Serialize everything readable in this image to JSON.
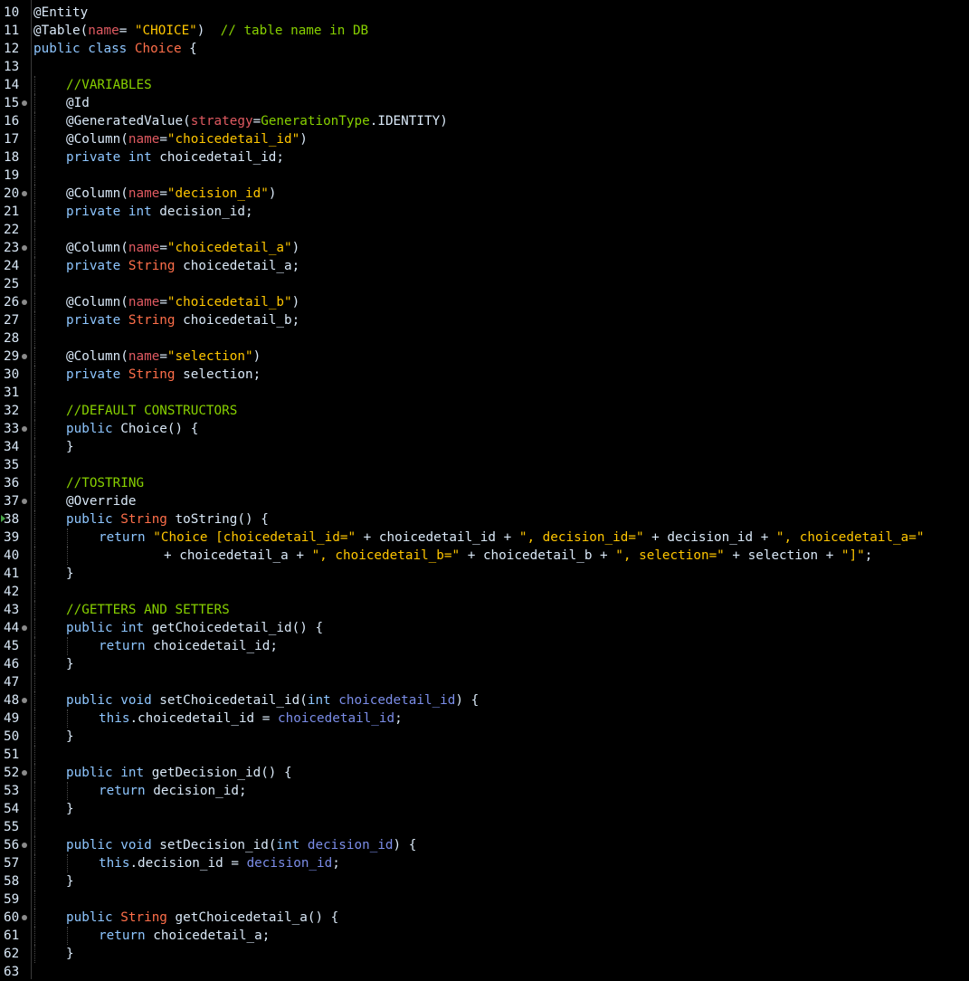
{
  "theme": {
    "background": "#000000",
    "colors": {
      "plain": "#d9e8f7",
      "keyword": "#8ec6ff",
      "annotation": "#d9e8f7",
      "attr": "#e05a61",
      "string": "#ffc600",
      "comment": "#87d000",
      "type": "#ff6f4a",
      "field": "#d9e8f7",
      "param": "#7b8de8",
      "enum": "#87d000",
      "method": "#d9e8f7"
    }
  },
  "editor": {
    "lines": [
      {
        "num": "10",
        "indent": 0,
        "tokens": [
          [
            "annotation",
            "@Entity"
          ]
        ]
      },
      {
        "num": "11",
        "indent": 0,
        "tokens": [
          [
            "annotation",
            "@Table("
          ],
          [
            "attr",
            "name"
          ],
          [
            "plain",
            "= "
          ],
          [
            "string",
            "\"CHOICE\""
          ],
          [
            "plain",
            ")  "
          ],
          [
            "comment",
            "// table name in DB"
          ]
        ]
      },
      {
        "num": "12",
        "indent": 0,
        "tokens": [
          [
            "keyword",
            "public class "
          ],
          [
            "type",
            "Choice"
          ],
          [
            "plain",
            " {"
          ]
        ]
      },
      {
        "num": "13",
        "indent": 0,
        "tokens": []
      },
      {
        "num": "14",
        "indent": 1,
        "tokens": [
          [
            "comment",
            "//VARIABLES"
          ]
        ]
      },
      {
        "num": "15",
        "indent": 1,
        "fold": true,
        "tokens": [
          [
            "annotation",
            "@Id"
          ]
        ]
      },
      {
        "num": "16",
        "indent": 1,
        "tokens": [
          [
            "annotation",
            "@GeneratedValue("
          ],
          [
            "attr",
            "strategy"
          ],
          [
            "plain",
            "="
          ],
          [
            "enum",
            "GenerationType"
          ],
          [
            "plain",
            ".IDENTITY)"
          ]
        ]
      },
      {
        "num": "17",
        "indent": 1,
        "tokens": [
          [
            "annotation",
            "@Column("
          ],
          [
            "attr",
            "name"
          ],
          [
            "plain",
            "="
          ],
          [
            "string",
            "\"choicedetail_id\""
          ],
          [
            "plain",
            ")"
          ]
        ]
      },
      {
        "num": "18",
        "indent": 1,
        "tokens": [
          [
            "keyword",
            "private int "
          ],
          [
            "field",
            "choicedetail_id"
          ],
          [
            "plain",
            ";"
          ]
        ]
      },
      {
        "num": "19",
        "indent": 1,
        "tokens": []
      },
      {
        "num": "20",
        "indent": 1,
        "fold": true,
        "tokens": [
          [
            "annotation",
            "@Column("
          ],
          [
            "attr",
            "name"
          ],
          [
            "plain",
            "="
          ],
          [
            "string",
            "\"decision_id\""
          ],
          [
            "plain",
            ")"
          ]
        ]
      },
      {
        "num": "21",
        "indent": 1,
        "tokens": [
          [
            "keyword",
            "private int "
          ],
          [
            "field",
            "decision_id"
          ],
          [
            "plain",
            ";"
          ]
        ]
      },
      {
        "num": "22",
        "indent": 1,
        "tokens": []
      },
      {
        "num": "23",
        "indent": 1,
        "fold": true,
        "tokens": [
          [
            "annotation",
            "@Column("
          ],
          [
            "attr",
            "name"
          ],
          [
            "plain",
            "="
          ],
          [
            "string",
            "\"choicedetail_a\""
          ],
          [
            "plain",
            ")"
          ]
        ]
      },
      {
        "num": "24",
        "indent": 1,
        "tokens": [
          [
            "keyword",
            "private "
          ],
          [
            "type",
            "String"
          ],
          [
            "plain",
            " "
          ],
          [
            "field",
            "choicedetail_a"
          ],
          [
            "plain",
            ";"
          ]
        ]
      },
      {
        "num": "25",
        "indent": 1,
        "tokens": []
      },
      {
        "num": "26",
        "indent": 1,
        "fold": true,
        "tokens": [
          [
            "annotation",
            "@Column("
          ],
          [
            "attr",
            "name"
          ],
          [
            "plain",
            "="
          ],
          [
            "string",
            "\"choicedetail_b\""
          ],
          [
            "plain",
            ")"
          ]
        ]
      },
      {
        "num": "27",
        "indent": 1,
        "tokens": [
          [
            "keyword",
            "private "
          ],
          [
            "type",
            "String"
          ],
          [
            "plain",
            " "
          ],
          [
            "field",
            "choicedetail_b"
          ],
          [
            "plain",
            ";"
          ]
        ]
      },
      {
        "num": "28",
        "indent": 1,
        "tokens": []
      },
      {
        "num": "29",
        "indent": 1,
        "fold": true,
        "tokens": [
          [
            "annotation",
            "@Column("
          ],
          [
            "attr",
            "name"
          ],
          [
            "plain",
            "="
          ],
          [
            "string",
            "\"selection\""
          ],
          [
            "plain",
            ")"
          ]
        ]
      },
      {
        "num": "30",
        "indent": 1,
        "tokens": [
          [
            "keyword",
            "private "
          ],
          [
            "type",
            "String"
          ],
          [
            "plain",
            " "
          ],
          [
            "field",
            "selection"
          ],
          [
            "plain",
            ";"
          ]
        ]
      },
      {
        "num": "31",
        "indent": 1,
        "tokens": []
      },
      {
        "num": "32",
        "indent": 1,
        "tokens": [
          [
            "comment",
            "//DEFAULT CONSTRUCTORS"
          ]
        ]
      },
      {
        "num": "33",
        "indent": 1,
        "fold": true,
        "tokens": [
          [
            "keyword",
            "public "
          ],
          [
            "method",
            "Choice"
          ],
          [
            "plain",
            "() {"
          ]
        ]
      },
      {
        "num": "34",
        "indent": 1,
        "tokens": [
          [
            "plain",
            "}"
          ]
        ]
      },
      {
        "num": "35",
        "indent": 1,
        "tokens": []
      },
      {
        "num": "36",
        "indent": 1,
        "tokens": [
          [
            "comment",
            "//TOSTRING"
          ]
        ]
      },
      {
        "num": "37",
        "indent": 1,
        "fold": true,
        "tokens": [
          [
            "annotation",
            "@Override"
          ]
        ]
      },
      {
        "num": "38",
        "indent": 1,
        "marker": true,
        "tokens": [
          [
            "keyword",
            "public "
          ],
          [
            "type",
            "String"
          ],
          [
            "plain",
            " "
          ],
          [
            "method",
            "toString"
          ],
          [
            "plain",
            "() {"
          ]
        ]
      },
      {
        "num": "39",
        "indent": 2,
        "tokens": [
          [
            "keyword",
            "return "
          ],
          [
            "string",
            "\"Choice [choicedetail_id=\""
          ],
          [
            "plain",
            " + "
          ],
          [
            "field",
            "choicedetail_id"
          ],
          [
            "plain",
            " + "
          ],
          [
            "string",
            "\", decision_id=\""
          ],
          [
            "plain",
            " + "
          ],
          [
            "field",
            "decision_id"
          ],
          [
            "plain",
            " + "
          ],
          [
            "string",
            "\", choicedetail_a=\""
          ]
        ]
      },
      {
        "num": "40",
        "indent": 4,
        "tokens": [
          [
            "plain",
            "+ "
          ],
          [
            "field",
            "choicedetail_a"
          ],
          [
            "plain",
            " + "
          ],
          [
            "string",
            "\", choicedetail_b=\""
          ],
          [
            "plain",
            " + "
          ],
          [
            "field",
            "choicedetail_b"
          ],
          [
            "plain",
            " + "
          ],
          [
            "string",
            "\", selection=\""
          ],
          [
            "plain",
            " + "
          ],
          [
            "field",
            "selection"
          ],
          [
            "plain",
            " + "
          ],
          [
            "string",
            "\"]\""
          ],
          [
            "plain",
            ";"
          ]
        ]
      },
      {
        "num": "41",
        "indent": 1,
        "tokens": [
          [
            "plain",
            "}"
          ]
        ]
      },
      {
        "num": "42",
        "indent": 1,
        "tokens": []
      },
      {
        "num": "43",
        "indent": 1,
        "tokens": [
          [
            "comment",
            "//GETTERS AND SETTERS"
          ]
        ]
      },
      {
        "num": "44",
        "indent": 1,
        "fold": true,
        "tokens": [
          [
            "keyword",
            "public int "
          ],
          [
            "method",
            "getChoicedetail_id"
          ],
          [
            "plain",
            "() {"
          ]
        ]
      },
      {
        "num": "45",
        "indent": 2,
        "tokens": [
          [
            "keyword",
            "return "
          ],
          [
            "field",
            "choicedetail_id"
          ],
          [
            "plain",
            ";"
          ]
        ]
      },
      {
        "num": "46",
        "indent": 1,
        "tokens": [
          [
            "plain",
            "}"
          ]
        ]
      },
      {
        "num": "47",
        "indent": 1,
        "tokens": []
      },
      {
        "num": "48",
        "indent": 1,
        "fold": true,
        "tokens": [
          [
            "keyword",
            "public void "
          ],
          [
            "method",
            "setChoicedetail_id"
          ],
          [
            "plain",
            "("
          ],
          [
            "keyword",
            "int "
          ],
          [
            "param",
            "choicedetail_id"
          ],
          [
            "plain",
            ") {"
          ]
        ]
      },
      {
        "num": "49",
        "indent": 2,
        "tokens": [
          [
            "keyword",
            "this"
          ],
          [
            "plain",
            "."
          ],
          [
            "field",
            "choicedetail_id"
          ],
          [
            "plain",
            " = "
          ],
          [
            "param",
            "choicedetail_id"
          ],
          [
            "plain",
            ";"
          ]
        ]
      },
      {
        "num": "50",
        "indent": 1,
        "tokens": [
          [
            "plain",
            "}"
          ]
        ]
      },
      {
        "num": "51",
        "indent": 1,
        "tokens": []
      },
      {
        "num": "52",
        "indent": 1,
        "fold": true,
        "tokens": [
          [
            "keyword",
            "public int "
          ],
          [
            "method",
            "getDecision_id"
          ],
          [
            "plain",
            "() {"
          ]
        ]
      },
      {
        "num": "53",
        "indent": 2,
        "tokens": [
          [
            "keyword",
            "return "
          ],
          [
            "field",
            "decision_id"
          ],
          [
            "plain",
            ";"
          ]
        ]
      },
      {
        "num": "54",
        "indent": 1,
        "tokens": [
          [
            "plain",
            "}"
          ]
        ]
      },
      {
        "num": "55",
        "indent": 1,
        "tokens": []
      },
      {
        "num": "56",
        "indent": 1,
        "fold": true,
        "tokens": [
          [
            "keyword",
            "public void "
          ],
          [
            "method",
            "setDecision_id"
          ],
          [
            "plain",
            "("
          ],
          [
            "keyword",
            "int "
          ],
          [
            "param",
            "decision_id"
          ],
          [
            "plain",
            ") {"
          ]
        ]
      },
      {
        "num": "57",
        "indent": 2,
        "tokens": [
          [
            "keyword",
            "this"
          ],
          [
            "plain",
            "."
          ],
          [
            "field",
            "decision_id"
          ],
          [
            "plain",
            " = "
          ],
          [
            "param",
            "decision_id"
          ],
          [
            "plain",
            ";"
          ]
        ]
      },
      {
        "num": "58",
        "indent": 1,
        "tokens": [
          [
            "plain",
            "}"
          ]
        ]
      },
      {
        "num": "59",
        "indent": 1,
        "tokens": []
      },
      {
        "num": "60",
        "indent": 1,
        "fold": true,
        "tokens": [
          [
            "keyword",
            "public "
          ],
          [
            "type",
            "String"
          ],
          [
            "plain",
            " "
          ],
          [
            "method",
            "getChoicedetail_a"
          ],
          [
            "plain",
            "() {"
          ]
        ]
      },
      {
        "num": "61",
        "indent": 2,
        "tokens": [
          [
            "keyword",
            "return "
          ],
          [
            "field",
            "choicedetail_a"
          ],
          [
            "plain",
            ";"
          ]
        ]
      },
      {
        "num": "62",
        "indent": 1,
        "tokens": [
          [
            "plain",
            "}"
          ]
        ]
      },
      {
        "num": "63",
        "indent": 0,
        "tokens": []
      }
    ]
  }
}
